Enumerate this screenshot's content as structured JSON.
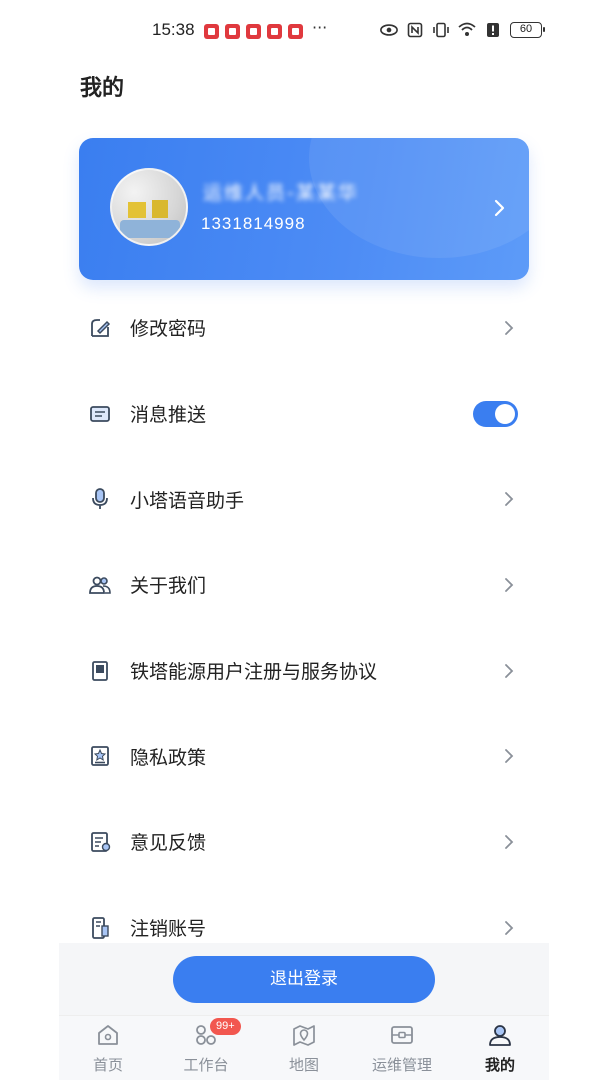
{
  "status_bar": {
    "time": "15:38",
    "more_indicator": "···",
    "battery_level": "60",
    "notification_icons": [
      "app-notification-icon",
      "app-notification-icon",
      "app-notification-icon",
      "app-notification-icon",
      "app-notification-icon"
    ],
    "system_icons": [
      "eye-icon",
      "nfc-icon",
      "vibrate-icon",
      "wifi-icon",
      "alert-icon"
    ]
  },
  "page": {
    "title": "我的"
  },
  "profile": {
    "name": "运维人员-某某华",
    "phone": "1331814998"
  },
  "menu": {
    "items": [
      {
        "label": "修改密码",
        "icon": "edit-password-icon",
        "type": "link"
      },
      {
        "label": "消息推送",
        "icon": "message-icon",
        "type": "toggle",
        "enabled": true
      },
      {
        "label": "小塔语音助手",
        "icon": "microphone-icon",
        "type": "link"
      },
      {
        "label": "关于我们",
        "icon": "users-icon",
        "type": "link"
      },
      {
        "label": "铁塔能源用户注册与服务协议",
        "icon": "document-icon",
        "type": "link"
      },
      {
        "label": "隐私政策",
        "icon": "privacy-icon",
        "type": "link"
      },
      {
        "label": "意见反馈",
        "icon": "feedback-icon",
        "type": "link"
      },
      {
        "label": "注销账号",
        "icon": "cancel-account-icon",
        "type": "link"
      }
    ]
  },
  "logout": {
    "label": "退出登录"
  },
  "tab_bar": {
    "tabs": [
      {
        "label": "首页",
        "icon": "home-icon"
      },
      {
        "label": "工作台",
        "icon": "workbench-icon",
        "badge": "99+"
      },
      {
        "label": "地图",
        "icon": "map-icon"
      },
      {
        "label": "运维管理",
        "icon": "maintenance-icon"
      },
      {
        "label": "我的",
        "icon": "profile-icon",
        "active": true
      }
    ]
  },
  "colors": {
    "accent": "#3a7ef0",
    "badge": "#f2574f",
    "text_primary": "#222222",
    "text_secondary": "#8a9099"
  }
}
